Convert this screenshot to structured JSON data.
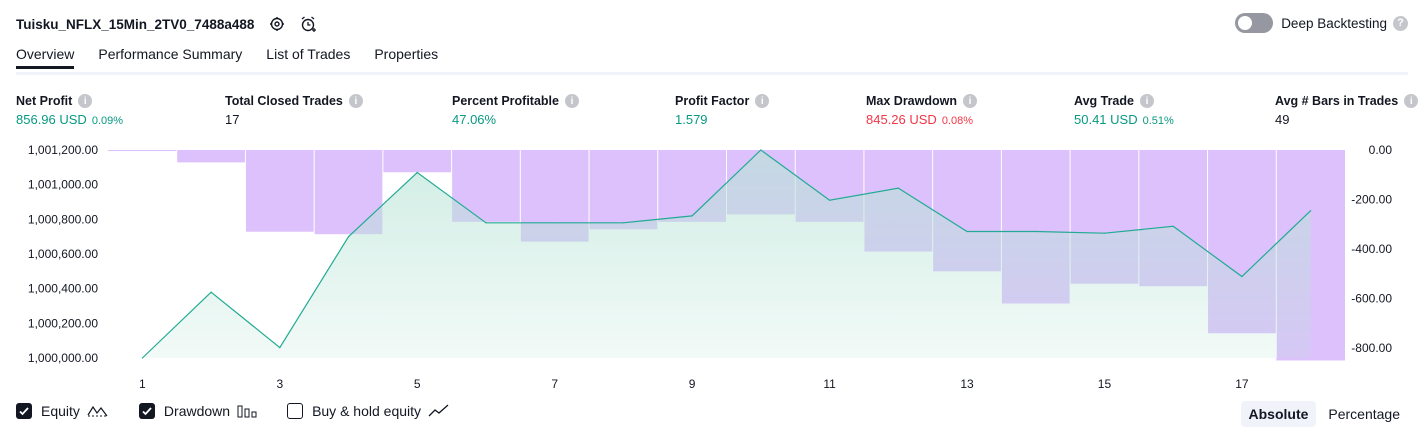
{
  "header": {
    "title": "Tuisku_NFLX_15Min_2TV0_7488a488",
    "deep_backtesting_label": "Deep Backtesting"
  },
  "tabs": [
    {
      "label": "Overview"
    },
    {
      "label": "Performance Summary"
    },
    {
      "label": "List of Trades"
    },
    {
      "label": "Properties"
    }
  ],
  "metrics": {
    "net_profit": {
      "label": "Net Profit",
      "value": "856.96 USD",
      "pct": "0.09%"
    },
    "total_closed_trades": {
      "label": "Total Closed Trades",
      "value": "17"
    },
    "percent_profitable": {
      "label": "Percent Profitable",
      "value": "47.06%"
    },
    "profit_factor": {
      "label": "Profit Factor",
      "value": "1.579"
    },
    "max_drawdown": {
      "label": "Max Drawdown",
      "value": "845.26 USD",
      "pct": "0.08%"
    },
    "avg_trade": {
      "label": "Avg Trade",
      "value": "50.41 USD",
      "pct": "0.51%"
    },
    "avg_bars": {
      "label": "Avg # Bars in Trades",
      "value": "49"
    }
  },
  "chart_data": {
    "type": "area",
    "x": [
      1,
      2,
      3,
      4,
      5,
      6,
      7,
      8,
      9,
      10,
      11,
      12,
      13,
      14,
      15,
      16,
      17,
      18
    ],
    "x_tick_labels": [
      "1",
      "3",
      "5",
      "7",
      "9",
      "11",
      "13",
      "15",
      "17"
    ],
    "series": [
      {
        "name": "Equity",
        "axis": "left",
        "values": [
          1000000,
          1000380,
          1000060,
          1000700,
          1001070,
          1000780,
          1000780,
          1000780,
          1000820,
          1001200,
          1000910,
          1000980,
          1000730,
          1000730,
          1000720,
          1000760,
          1000470,
          1000850
        ]
      },
      {
        "name": "Drawdown",
        "axis": "right",
        "values": [
          0,
          -50,
          -330,
          -340,
          -90,
          -290,
          -370,
          -320,
          -290,
          -260,
          -290,
          -410,
          -490,
          -620,
          -540,
          -550,
          -740,
          -850
        ]
      }
    ],
    "left_axis": {
      "ylim": [
        1000000,
        1001200
      ],
      "tick_labels": [
        "1,001,200.00",
        "1,001,000.00",
        "1,000,800.00",
        "1,000,600.00",
        "1,000,400.00",
        "1,000,200.00",
        "1,000,000.00"
      ]
    },
    "right_axis": {
      "ylim": [
        -840,
        0
      ],
      "tick_labels": [
        "0.00",
        "-200.00",
        "-400.00",
        "-600.00",
        "-800.00"
      ]
    },
    "colors": {
      "equity_line": "#22ab94",
      "equity_fill_top": "#b9e4d7",
      "drawdown_fill": "#c9a0fb"
    }
  },
  "legend": [
    {
      "label": "Equity",
      "checked": true,
      "icon": "equity-wave-icon"
    },
    {
      "label": "Drawdown",
      "checked": true,
      "icon": "drawdown-bars-icon"
    },
    {
      "label": "Buy & hold equity",
      "checked": false,
      "icon": "buy-hold-line-icon"
    }
  ],
  "modes": {
    "absolute": "Absolute",
    "percentage": "Percentage",
    "selected": "Absolute"
  }
}
